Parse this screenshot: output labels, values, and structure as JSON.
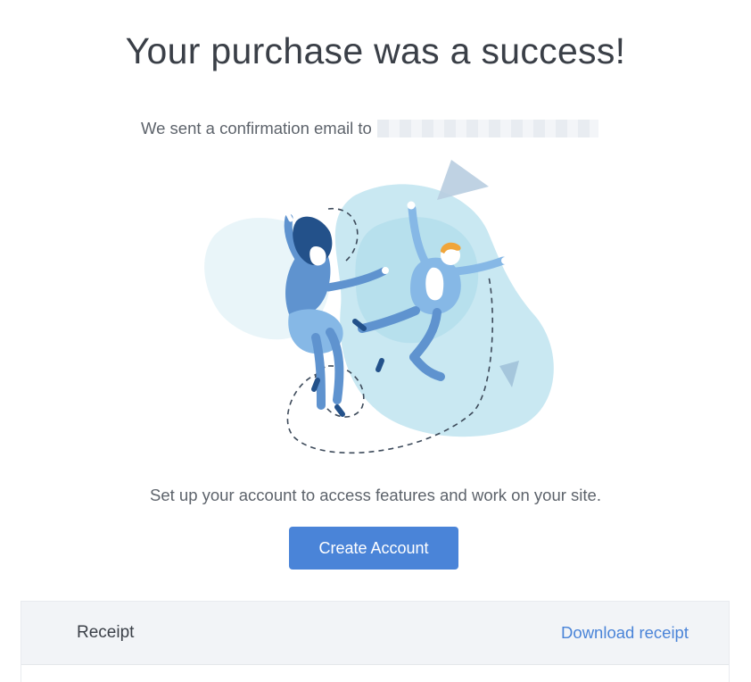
{
  "header": {
    "title": "Your purchase was a success!"
  },
  "confirmation": {
    "text": "We sent a confirmation email to",
    "email_redacted": true
  },
  "illustration": {
    "name": "celebrating-people-illustration",
    "colors": {
      "blob": "#bfe4f0",
      "blob_light": "#dff1f7",
      "figure": "#5f93cf",
      "figure_light": "#86b8e6",
      "hair_woman": "#23518a",
      "hair_man": "#f0a53a",
      "skin": "#ffffff",
      "dashed": "#3d4a5a"
    }
  },
  "setup": {
    "text": "Set up your account to access features and work on your site."
  },
  "cta": {
    "create_account_label": "Create Account",
    "color": "#4a84d8"
  },
  "receipt": {
    "title": "Receipt",
    "download_label": "Download receipt"
  }
}
